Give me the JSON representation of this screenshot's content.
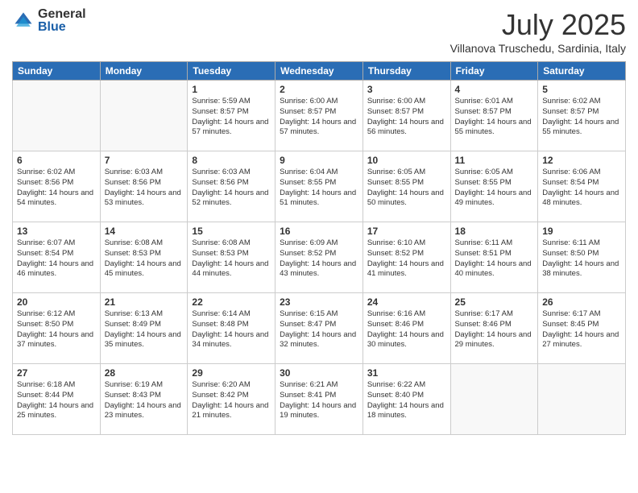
{
  "header": {
    "logo_general": "General",
    "logo_blue": "Blue",
    "month_year": "July 2025",
    "subtitle": "Villanova Truschedu, Sardinia, Italy"
  },
  "weekdays": [
    "Sunday",
    "Monday",
    "Tuesday",
    "Wednesday",
    "Thursday",
    "Friday",
    "Saturday"
  ],
  "weeks": [
    [
      {
        "day": "",
        "sunrise": "",
        "sunset": "",
        "daylight": ""
      },
      {
        "day": "",
        "sunrise": "",
        "sunset": "",
        "daylight": ""
      },
      {
        "day": "1",
        "sunrise": "Sunrise: 5:59 AM",
        "sunset": "Sunset: 8:57 PM",
        "daylight": "Daylight: 14 hours and 57 minutes."
      },
      {
        "day": "2",
        "sunrise": "Sunrise: 6:00 AM",
        "sunset": "Sunset: 8:57 PM",
        "daylight": "Daylight: 14 hours and 57 minutes."
      },
      {
        "day": "3",
        "sunrise": "Sunrise: 6:00 AM",
        "sunset": "Sunset: 8:57 PM",
        "daylight": "Daylight: 14 hours and 56 minutes."
      },
      {
        "day": "4",
        "sunrise": "Sunrise: 6:01 AM",
        "sunset": "Sunset: 8:57 PM",
        "daylight": "Daylight: 14 hours and 55 minutes."
      },
      {
        "day": "5",
        "sunrise": "Sunrise: 6:02 AM",
        "sunset": "Sunset: 8:57 PM",
        "daylight": "Daylight: 14 hours and 55 minutes."
      }
    ],
    [
      {
        "day": "6",
        "sunrise": "Sunrise: 6:02 AM",
        "sunset": "Sunset: 8:56 PM",
        "daylight": "Daylight: 14 hours and 54 minutes."
      },
      {
        "day": "7",
        "sunrise": "Sunrise: 6:03 AM",
        "sunset": "Sunset: 8:56 PM",
        "daylight": "Daylight: 14 hours and 53 minutes."
      },
      {
        "day": "8",
        "sunrise": "Sunrise: 6:03 AM",
        "sunset": "Sunset: 8:56 PM",
        "daylight": "Daylight: 14 hours and 52 minutes."
      },
      {
        "day": "9",
        "sunrise": "Sunrise: 6:04 AM",
        "sunset": "Sunset: 8:55 PM",
        "daylight": "Daylight: 14 hours and 51 minutes."
      },
      {
        "day": "10",
        "sunrise": "Sunrise: 6:05 AM",
        "sunset": "Sunset: 8:55 PM",
        "daylight": "Daylight: 14 hours and 50 minutes."
      },
      {
        "day": "11",
        "sunrise": "Sunrise: 6:05 AM",
        "sunset": "Sunset: 8:55 PM",
        "daylight": "Daylight: 14 hours and 49 minutes."
      },
      {
        "day": "12",
        "sunrise": "Sunrise: 6:06 AM",
        "sunset": "Sunset: 8:54 PM",
        "daylight": "Daylight: 14 hours and 48 minutes."
      }
    ],
    [
      {
        "day": "13",
        "sunrise": "Sunrise: 6:07 AM",
        "sunset": "Sunset: 8:54 PM",
        "daylight": "Daylight: 14 hours and 46 minutes."
      },
      {
        "day": "14",
        "sunrise": "Sunrise: 6:08 AM",
        "sunset": "Sunset: 8:53 PM",
        "daylight": "Daylight: 14 hours and 45 minutes."
      },
      {
        "day": "15",
        "sunrise": "Sunrise: 6:08 AM",
        "sunset": "Sunset: 8:53 PM",
        "daylight": "Daylight: 14 hours and 44 minutes."
      },
      {
        "day": "16",
        "sunrise": "Sunrise: 6:09 AM",
        "sunset": "Sunset: 8:52 PM",
        "daylight": "Daylight: 14 hours and 43 minutes."
      },
      {
        "day": "17",
        "sunrise": "Sunrise: 6:10 AM",
        "sunset": "Sunset: 8:52 PM",
        "daylight": "Daylight: 14 hours and 41 minutes."
      },
      {
        "day": "18",
        "sunrise": "Sunrise: 6:11 AM",
        "sunset": "Sunset: 8:51 PM",
        "daylight": "Daylight: 14 hours and 40 minutes."
      },
      {
        "day": "19",
        "sunrise": "Sunrise: 6:11 AM",
        "sunset": "Sunset: 8:50 PM",
        "daylight": "Daylight: 14 hours and 38 minutes."
      }
    ],
    [
      {
        "day": "20",
        "sunrise": "Sunrise: 6:12 AM",
        "sunset": "Sunset: 8:50 PM",
        "daylight": "Daylight: 14 hours and 37 minutes."
      },
      {
        "day": "21",
        "sunrise": "Sunrise: 6:13 AM",
        "sunset": "Sunset: 8:49 PM",
        "daylight": "Daylight: 14 hours and 35 minutes."
      },
      {
        "day": "22",
        "sunrise": "Sunrise: 6:14 AM",
        "sunset": "Sunset: 8:48 PM",
        "daylight": "Daylight: 14 hours and 34 minutes."
      },
      {
        "day": "23",
        "sunrise": "Sunrise: 6:15 AM",
        "sunset": "Sunset: 8:47 PM",
        "daylight": "Daylight: 14 hours and 32 minutes."
      },
      {
        "day": "24",
        "sunrise": "Sunrise: 6:16 AM",
        "sunset": "Sunset: 8:46 PM",
        "daylight": "Daylight: 14 hours and 30 minutes."
      },
      {
        "day": "25",
        "sunrise": "Sunrise: 6:17 AM",
        "sunset": "Sunset: 8:46 PM",
        "daylight": "Daylight: 14 hours and 29 minutes."
      },
      {
        "day": "26",
        "sunrise": "Sunrise: 6:17 AM",
        "sunset": "Sunset: 8:45 PM",
        "daylight": "Daylight: 14 hours and 27 minutes."
      }
    ],
    [
      {
        "day": "27",
        "sunrise": "Sunrise: 6:18 AM",
        "sunset": "Sunset: 8:44 PM",
        "daylight": "Daylight: 14 hours and 25 minutes."
      },
      {
        "day": "28",
        "sunrise": "Sunrise: 6:19 AM",
        "sunset": "Sunset: 8:43 PM",
        "daylight": "Daylight: 14 hours and 23 minutes."
      },
      {
        "day": "29",
        "sunrise": "Sunrise: 6:20 AM",
        "sunset": "Sunset: 8:42 PM",
        "daylight": "Daylight: 14 hours and 21 minutes."
      },
      {
        "day": "30",
        "sunrise": "Sunrise: 6:21 AM",
        "sunset": "Sunset: 8:41 PM",
        "daylight": "Daylight: 14 hours and 19 minutes."
      },
      {
        "day": "31",
        "sunrise": "Sunrise: 6:22 AM",
        "sunset": "Sunset: 8:40 PM",
        "daylight": "Daylight: 14 hours and 18 minutes."
      },
      {
        "day": "",
        "sunrise": "",
        "sunset": "",
        "daylight": ""
      },
      {
        "day": "",
        "sunrise": "",
        "sunset": "",
        "daylight": ""
      }
    ]
  ]
}
